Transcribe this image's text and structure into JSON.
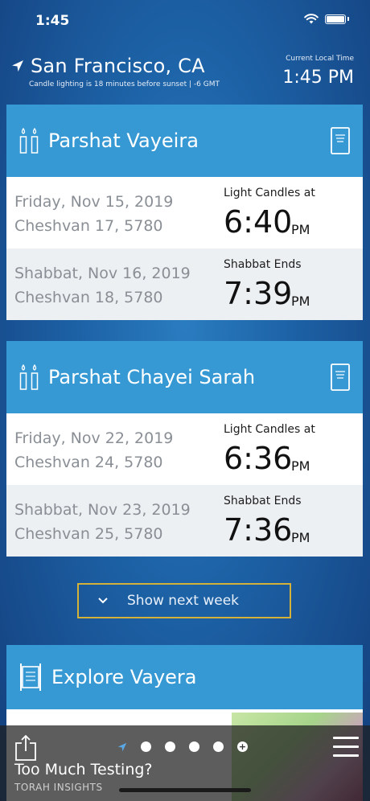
{
  "status_bar": {
    "time": "1:45"
  },
  "header": {
    "city": "San Francisco, CA",
    "candle_note": "Candle lighting is 18 minutes before sunset | -6 GMT",
    "local_time_label": "Current Local Time",
    "local_time": "1:45 PM"
  },
  "weeks": [
    {
      "parsha": "Parshat Vayeira",
      "rows": [
        {
          "date": "Friday, Nov 15, 2019",
          "hebrew_date": "Cheshvan 17, 5780",
          "label": "Light Candles at",
          "time": "6:40",
          "ampm": "PM"
        },
        {
          "date": "Shabbat, Nov 16, 2019",
          "hebrew_date": "Cheshvan 18, 5780",
          "label": "Shabbat Ends",
          "time": "7:39",
          "ampm": "PM"
        }
      ]
    },
    {
      "parsha": "Parshat Chayei Sarah",
      "rows": [
        {
          "date": "Friday, Nov 22, 2019",
          "hebrew_date": "Cheshvan 24, 5780",
          "label": "Light Candles at",
          "time": "6:36",
          "ampm": "PM"
        },
        {
          "date": "Shabbat, Nov 23, 2019",
          "hebrew_date": "Cheshvan 25, 5780",
          "label": "Shabbat Ends",
          "time": "7:36",
          "ampm": "PM"
        }
      ]
    }
  ],
  "show_next_week": "Show next week",
  "explore": {
    "title": "Explore Vayera"
  },
  "bottom_bar": {
    "article_title": "Too Much Testing?",
    "article_subtitle": "TORAH INSIGHTS"
  },
  "colors": {
    "card_header": "#3799d4",
    "button_border": "#d4b23a",
    "background": "#1c5fa3"
  },
  "icons": {
    "location": "location-arrow-icon",
    "candles": "candles-icon",
    "book": "siddur-book-icon",
    "torah": "torah-scroll-icon",
    "share": "share-icon",
    "menu": "hamburger-menu-icon"
  }
}
